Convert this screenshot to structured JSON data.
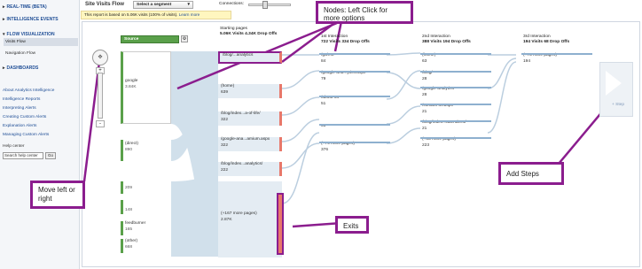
{
  "sidebar": {
    "sections": [
      "REAL-TIME (BETA)",
      "INTELLIGENCE EVENTS",
      "FLOW VISUALIZATION",
      "DASHBOARDS"
    ],
    "flow_items": [
      "Visits Flow",
      "Navigation Flow"
    ],
    "links": [
      "About Analytics Intelligence",
      "Intelligence Reports",
      "Interpreting Alerts",
      "Creating Custom Alerts",
      "Explanation Alerts",
      "Managing Custom Alerts"
    ],
    "help_center_label": "Help center",
    "help_input_value": "Search help center",
    "go_label": "Go"
  },
  "header": {
    "title": "Site Visits Flow",
    "segment_label": "Select a segment",
    "connections_label": "Connections:",
    "notice_text": "This report is based on 5.06K visits (100% of visits).",
    "notice_link": "Learn more"
  },
  "source": {
    "dropdown_label": "Source",
    "nodes": [
      {
        "name": "google",
        "value": "3.84K"
      },
      {
        "name": "(direct)",
        "value": "890"
      },
      {
        "name": "",
        "value": "209"
      },
      {
        "name": "",
        "value": "148"
      },
      {
        "name": "feedburner",
        "value": "165"
      },
      {
        "name": "(other)",
        "value": "668"
      }
    ]
  },
  "columns": [
    {
      "title": "Starting pages",
      "stats": "5.06K Visits 4.34K Drop Offs"
    },
    {
      "title": "1st Interaction",
      "stats": "722 Visits 334 Drop Offs"
    },
    {
      "title": "2nd Interaction",
      "stats": "388 Visits 194 Drop Offs"
    },
    {
      "title": "3rd Interaction",
      "stats": "194 Visits 68 Drop Offs"
    }
  ],
  "starting_pages": [
    {
      "name": "/blog/...analytics",
      "value": ""
    },
    {
      "name": "(home)",
      "value": "639"
    },
    {
      "name": "/blog/index...a-of-life/",
      "value": "322"
    },
    {
      "name": "/google-ana...amium.aspx",
      "value": "322"
    },
    {
      "name": "/blog/index...analytics/",
      "value": "222"
    },
    {
      "name": "(+167 more pages)",
      "value": "2.87K"
    }
  ],
  "first_interaction": [
    {
      "name": "/go/est",
      "value": "84"
    },
    {
      "name": "/google-ana...ytics.aspx",
      "value": "79"
    },
    {
      "name": "/about-us",
      "value": "51"
    },
    {
      "name": "",
      "value": "51"
    },
    {
      "name": "(+74 more pages)",
      "value": "376"
    }
  ],
  "second_interaction": [
    {
      "name": "(home)",
      "value": "63"
    },
    {
      "name": "/blog/",
      "value": "28"
    },
    {
      "name": "/google-analytics",
      "value": "28"
    },
    {
      "name": "/contact-us.aspx",
      "value": "21"
    },
    {
      "name": "/blog/index...attendees/",
      "value": "21"
    },
    {
      "name": "(+83 more pages)",
      "value": "223"
    }
  ],
  "third_interaction": [
    {
      "name": "(+73 more pages)",
      "value": "194"
    }
  ],
  "add_step_label": "+ Step",
  "zoom": {
    "plus": "+",
    "minus": "-"
  },
  "callouts": {
    "nodes": "Nodes: Left Click for more options",
    "move": "Move left or right",
    "add_steps": "Add Steps",
    "exits": "Exits"
  },
  "colors": {
    "accent": "#8b1d8e",
    "link": "#1f4e96",
    "flow": "#c9dbe8",
    "exit": "#e8786a",
    "source": "#5aa04a"
  }
}
